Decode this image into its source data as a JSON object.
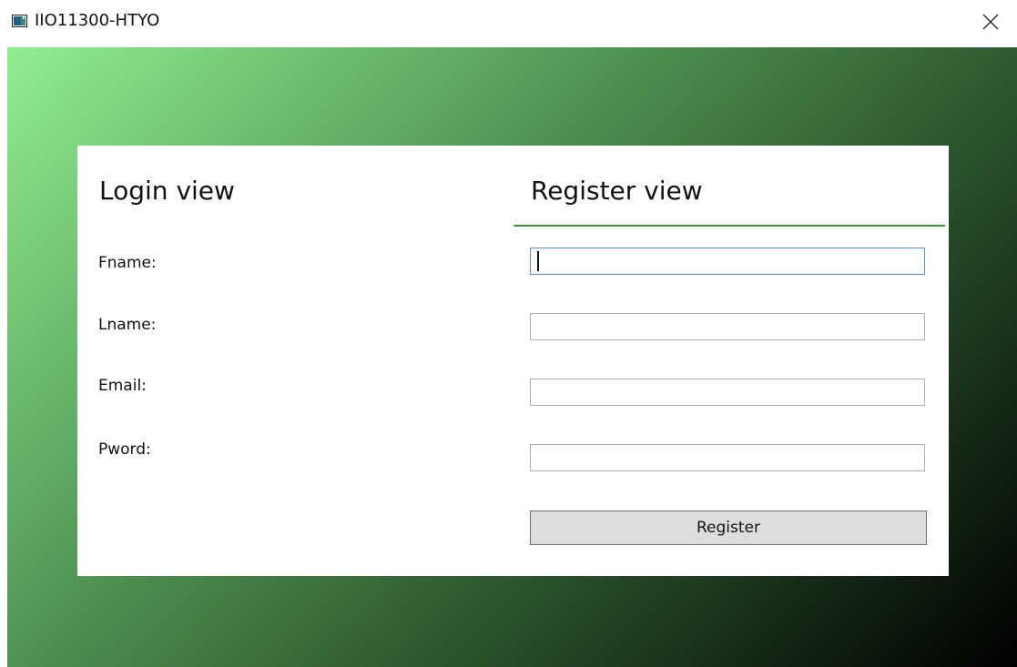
{
  "window": {
    "title": "IIO11300-HTYO",
    "icon": "app-window-icon",
    "close_icon": "close-icon"
  },
  "colors": {
    "gradient_start": "#90ee90",
    "gradient_end": "#000000",
    "tab_underline": "#3d9b3d",
    "focused_border": "#5b8fd6",
    "button_bg": "#dddddd"
  },
  "login_view": {
    "title": "Login view"
  },
  "register_view": {
    "title": "Register view",
    "labels": {
      "fname": "Fname:",
      "lname": "Lname:",
      "email": "Email:",
      "pword": "Pword:"
    },
    "fields": {
      "fname": {
        "value": "",
        "focused": true
      },
      "lname": {
        "value": ""
      },
      "email": {
        "value": ""
      },
      "pword": {
        "value": ""
      }
    },
    "register_button": "Register"
  }
}
